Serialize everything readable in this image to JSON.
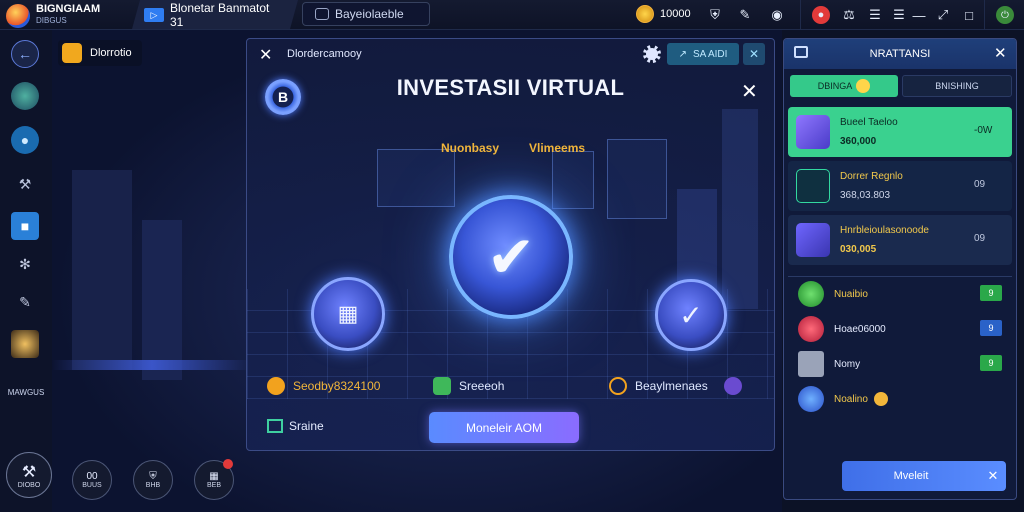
{
  "topbar": {
    "app_name": "BIGNGIAAM",
    "app_sub": "DIBGUS",
    "tab1_label": "Blonetar Banmatot 31",
    "tab2_label": "Bayeiolaeble",
    "coins_value": "10000"
  },
  "sidebar": {
    "bottom_label": "MAWGUS"
  },
  "bottom_buttons": [
    {
      "icon": "tools-icon",
      "label": "DIOBO"
    },
    {
      "icon": "timer-icon",
      "label": "BUUS",
      "value": "00"
    },
    {
      "icon": "shield-icon",
      "label": "BHB"
    },
    {
      "icon": "gift-icon",
      "label": "BEB"
    }
  ],
  "scene": {
    "top_pill_label": "Dlorrotio"
  },
  "panel": {
    "header_name": "Dlordercamooy",
    "header_pill": "SA AIDI",
    "title": "INVESTASII VIRTUAL",
    "label_left": "Nuonbasy",
    "label_right": "Vlimeems",
    "stats": [
      {
        "label": "Seodby8324100",
        "color": "#f2b63a"
      },
      {
        "label": "Sreeeoh",
        "color": "#e6ecff"
      },
      {
        "label": "Beaylmenaes",
        "color": "#e6ecff"
      }
    ],
    "bottom_left_label": "Sraine",
    "main_button": "Moneleir AOM"
  },
  "rightpanel": {
    "title": "NRATTANSI",
    "tabs": [
      "DBINGA",
      "BNISHING"
    ],
    "investments": [
      {
        "name": "Bueel Taeloo",
        "value": "360,000",
        "change": "-0W",
        "icon": "chart-chip-icon",
        "highlight": true
      },
      {
        "name": "Dorrer Regnlo",
        "value": "368,03.803",
        "change": "09",
        "icon": "growth-chart-icon",
        "highlight": false
      },
      {
        "name": "Hnrbleioulasonoode",
        "value": "030,005",
        "change": "09",
        "icon": "cube-icon",
        "highlight": false
      }
    ],
    "list": [
      {
        "label": "Nuaibio",
        "badge": "9",
        "icon": "green-gem-icon",
        "badge_color": "#2aa84a"
      },
      {
        "label": "Hoae06000",
        "badge": "9",
        "icon": "red-gem-icon",
        "badge_color": "#2a62c8"
      },
      {
        "label": "Nomy",
        "badge": "9",
        "icon": "box-icon",
        "badge_color": "#2aa84a"
      },
      {
        "label": "Noalino",
        "badge": "",
        "icon": "blue-pill-icon",
        "badge_color": ""
      }
    ],
    "action_button": "Mveleit"
  }
}
